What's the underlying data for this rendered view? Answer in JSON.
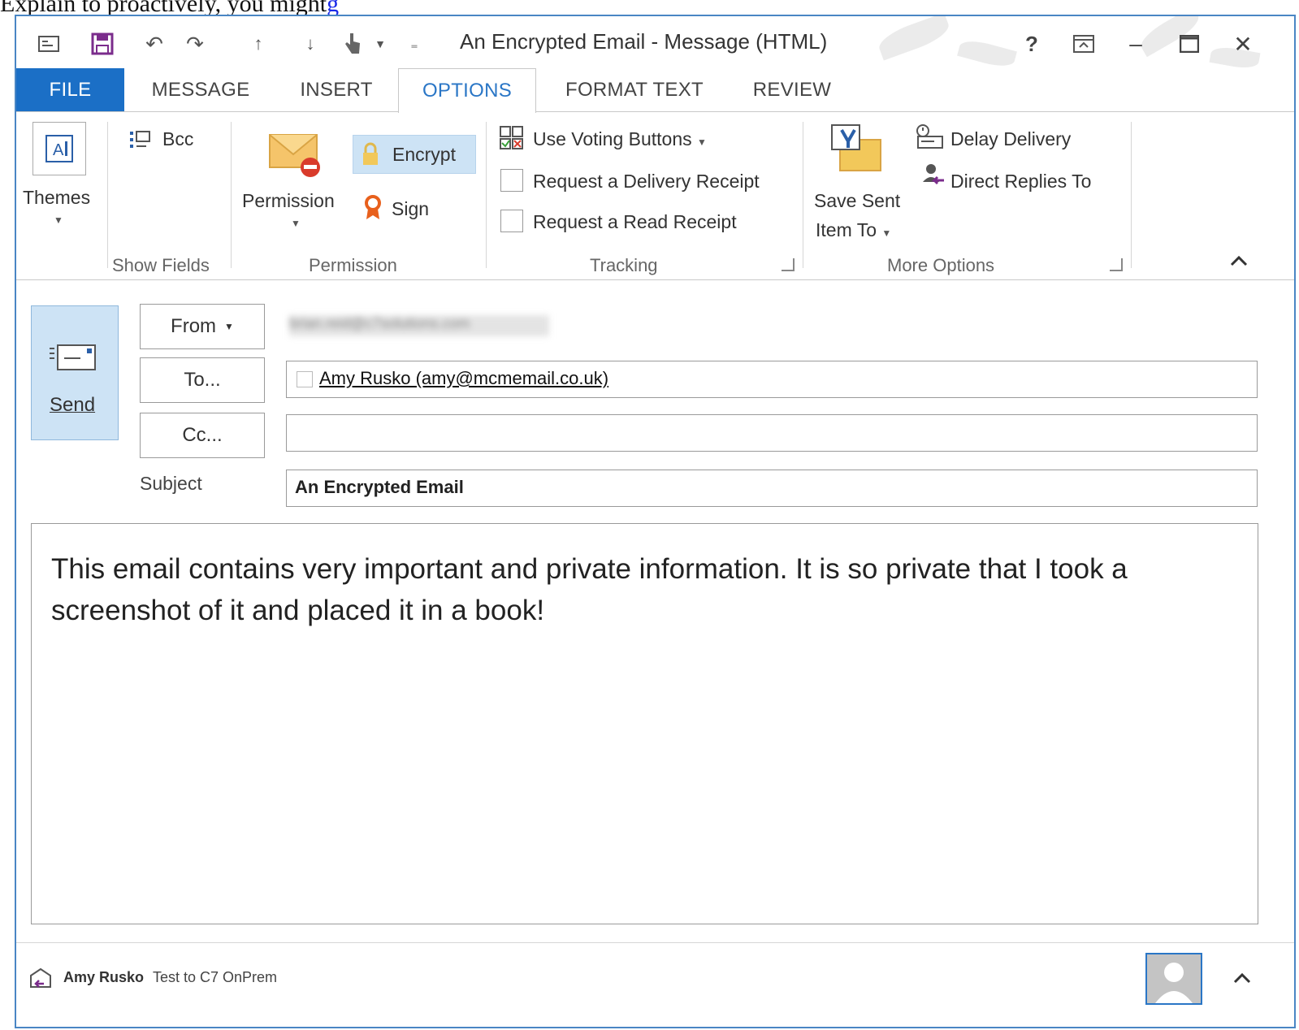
{
  "caption": {
    "before": "Explain to proactively, you might",
    "link": "g"
  },
  "window": {
    "title": "An Encrypted Email - Message (HTML)",
    "help": "?",
    "minimize": "–",
    "close": "✕"
  },
  "tabs": [
    "FILE",
    "MESSAGE",
    "INSERT",
    "OPTIONS",
    "FORMAT TEXT",
    "REVIEW"
  ],
  "ribbon": {
    "themes": {
      "label": "Themes"
    },
    "show_fields": {
      "bcc": "Bcc",
      "group": "Show Fields"
    },
    "permission": {
      "permission_btn": "Permission",
      "encrypt": "Encrypt",
      "sign": "Sign",
      "group": "Permission"
    },
    "tracking": {
      "voting": "Use Voting Buttons",
      "delivery_receipt": "Request a Delivery Receipt",
      "read_receipt": "Request a Read Receipt",
      "group": "Tracking"
    },
    "more_options": {
      "save_sent_line1": "Save Sent",
      "save_sent_line2": "Item To",
      "delay_delivery": "Delay Delivery",
      "direct_replies": "Direct Replies To",
      "group": "More Options"
    }
  },
  "compose": {
    "send": "Send",
    "from_btn": "From",
    "to_btn": "To...",
    "cc_btn": "Cc...",
    "subject_label": "Subject",
    "from_value": "brian.reid@c7solutions.com",
    "to_value": "Amy Rusko (amy@mcmemail.co.uk)",
    "cc_value": "",
    "subject_value": "An Encrypted Email",
    "body": "This email contains very important and private information. It is so private that I took a screenshot of it and placed it in a book!"
  },
  "people_pane": {
    "name": "Amy Rusko",
    "status": "Test to C7 OnPrem"
  },
  "colors": {
    "file_tab": "#1b6fc6",
    "active_tab_text": "#2a76c6",
    "encrypt_highlight": "#cde3f5",
    "send_bg": "#cde3f5",
    "sign_icon": "#e8601c",
    "frame": "#4a86c4"
  },
  "icons": [
    "message-icon",
    "save-icon",
    "undo-icon",
    "redo-icon",
    "up-arrow-icon",
    "down-arrow-icon",
    "touch-mode-icon",
    "customize-qat-icon",
    "help-icon",
    "ribbon-display-icon",
    "minimize-icon",
    "maximize-icon",
    "close-icon",
    "themes-icon",
    "bcc-icon",
    "permission-envelope-icon",
    "lock-icon",
    "ribbon-sign-icon",
    "voting-icon",
    "save-sent-icon",
    "delay-delivery-icon",
    "direct-replies-icon",
    "send-envelope-icon",
    "contact-card-icon",
    "avatar-icon",
    "collapse-icon"
  ]
}
